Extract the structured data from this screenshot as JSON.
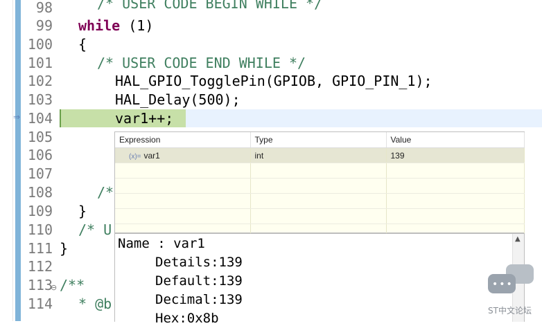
{
  "editor": {
    "line_numbers": [
      "98",
      "99",
      "100",
      "101",
      "102",
      "103",
      "104",
      "105",
      "106",
      "107",
      "108",
      "109",
      "110",
      "111",
      "112",
      "113",
      "114"
    ],
    "lines": {
      "l98": "/* USER CODE BEGIN WHILE */",
      "l99_kw": "while",
      "l99_rest": " (1)",
      "l100": "{",
      "l101": "/* USER CODE END WHILE */",
      "l102": "HAL_GPIO_TogglePin(GPIOB, GPIO_PIN_1);",
      "l103": "HAL_Delay(500);",
      "l104": "var1++;",
      "l108": "/*",
      "l109": "}",
      "l110": "/* U",
      "l111": "}",
      "l113": "/**",
      "l114": "* @b"
    },
    "fold_marker": "⊖",
    "exec_arrow": "⇒"
  },
  "expressions": {
    "headers": [
      "Expression",
      "Type",
      "Value"
    ],
    "rows": [
      {
        "icon": "(x)=",
        "name": "var1",
        "type": "int",
        "value": "139"
      }
    ]
  },
  "details": {
    "name_line": "Name : var1",
    "details_line": "Details:139",
    "default_line": "Default:139",
    "decimal_line": "Decimal:139",
    "hex_line": "Hex:0x8b"
  },
  "watermark": {
    "text": "ST中文论坛"
  },
  "colors": {
    "keyword": "#7f0055",
    "comment": "#3f7f5f",
    "current_line": "#c7e0a8",
    "popup_bg": "#fffff0"
  }
}
